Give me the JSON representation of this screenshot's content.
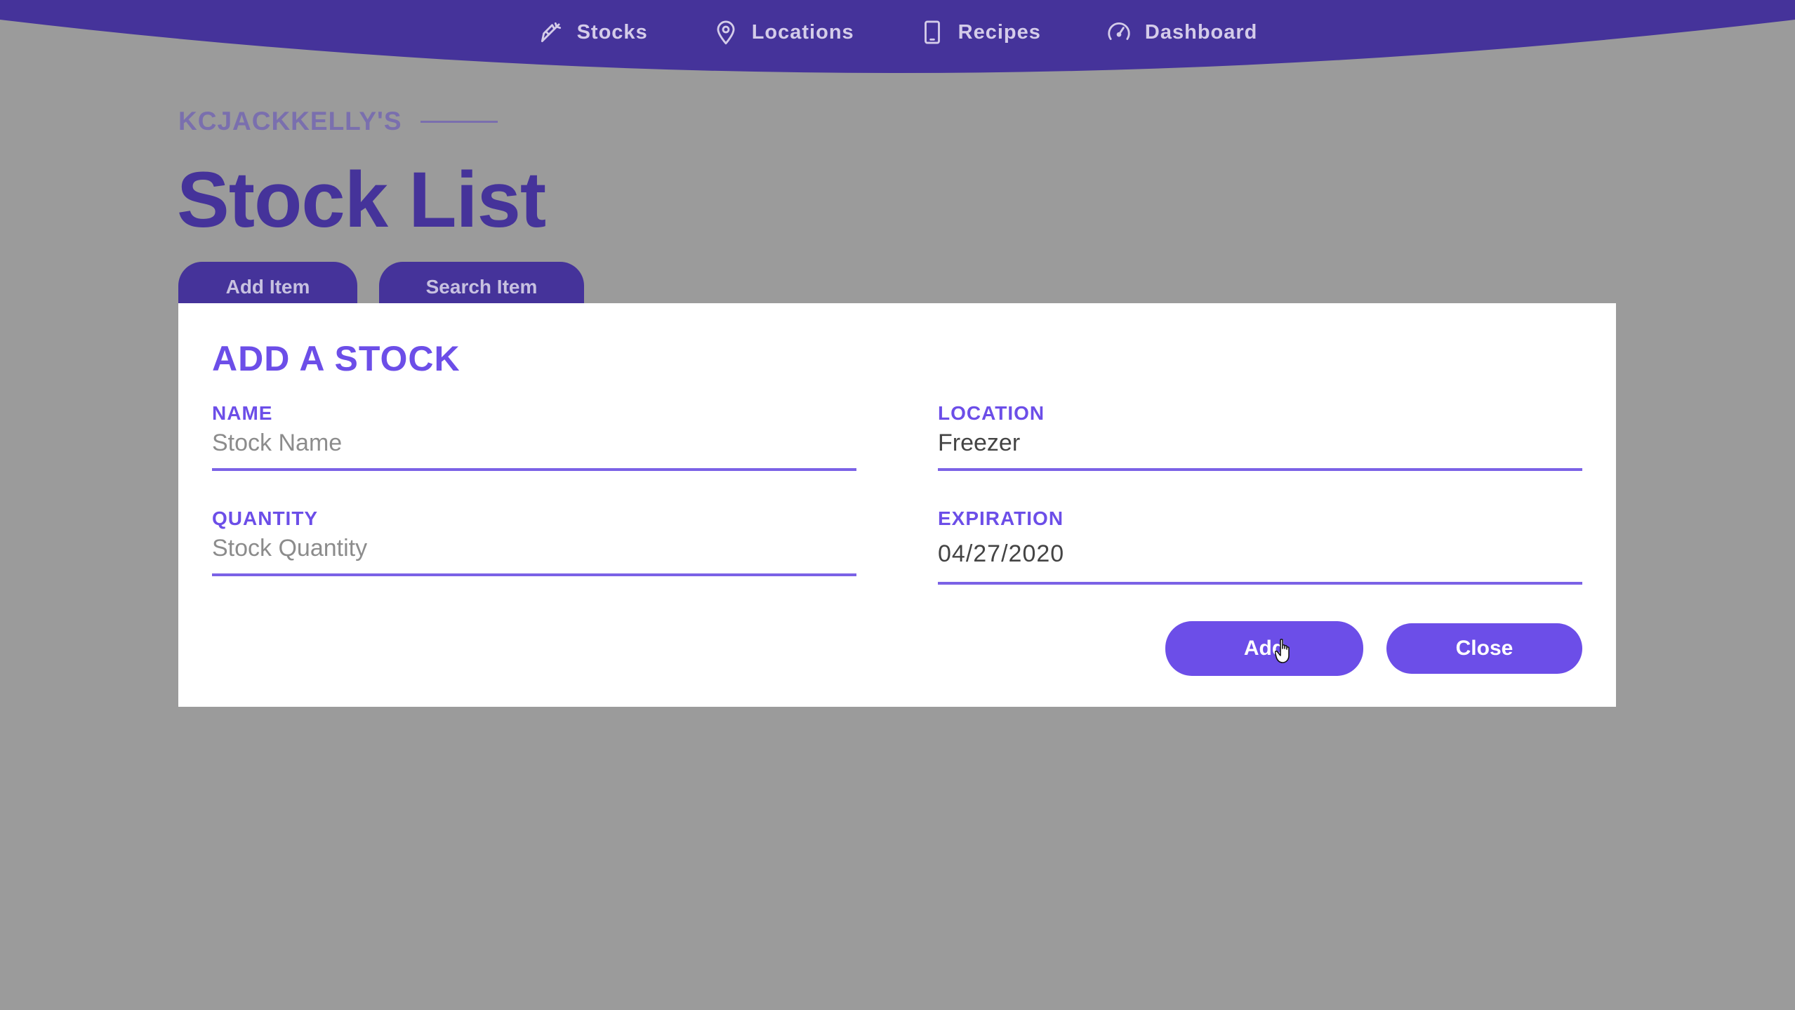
{
  "nav": {
    "items": [
      {
        "label": "Stocks",
        "icon": "carrot-icon"
      },
      {
        "label": "Locations",
        "icon": "map-pin-icon"
      },
      {
        "label": "Recipes",
        "icon": "tablet-icon"
      },
      {
        "label": "Dashboard",
        "icon": "speedometer-icon"
      }
    ]
  },
  "header": {
    "owner": "KCJACKKELLY'S",
    "title": "Stock List",
    "add_item_label": "Add Item",
    "search_item_label": "Search Item"
  },
  "modal": {
    "title": "ADD A STOCK",
    "fields": {
      "name": {
        "label": "NAME",
        "value": "",
        "placeholder": "Stock Name"
      },
      "location": {
        "label": "LOCATION",
        "value": "Freezer"
      },
      "quantity": {
        "label": "QUANTITY",
        "value": "",
        "placeholder": "Stock Quantity"
      },
      "expiration": {
        "label": "EXPIRATION",
        "value": "04/27/2020"
      }
    },
    "add_label": "Add",
    "close_label": "Close"
  },
  "colors": {
    "nav_bg": "#45339a",
    "accent": "#6c4ee8",
    "overlay_bg": "#9b9b9b",
    "title": "#45339a"
  }
}
